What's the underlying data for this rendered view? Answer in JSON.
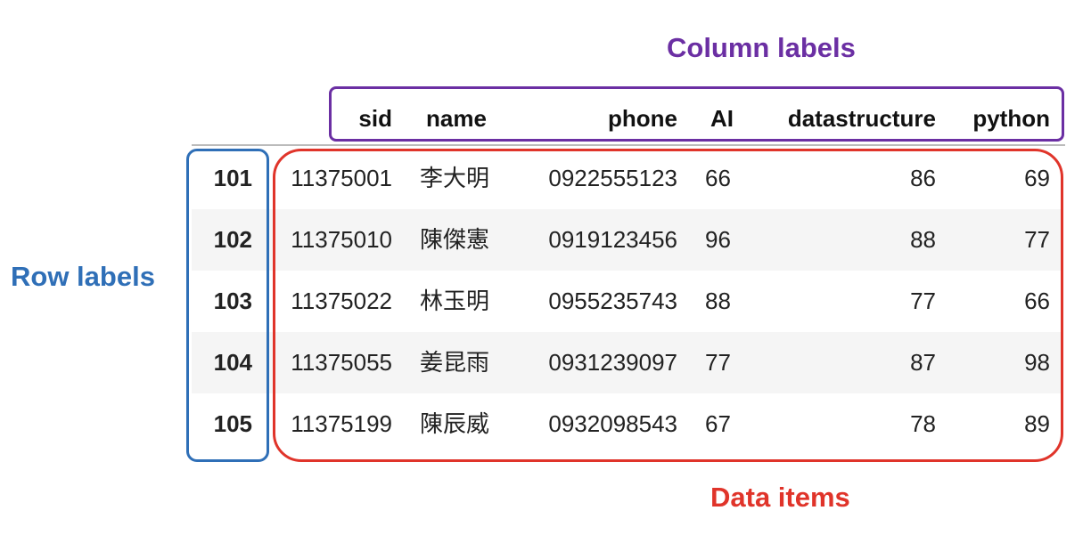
{
  "annotations": {
    "column_labels": {
      "text": "Column labels",
      "color": "#6b2fa3"
    },
    "row_labels": {
      "text": "Row labels",
      "color": "#2f6fb7"
    },
    "data_items": {
      "text": "Data items",
      "color": "#e0342a"
    }
  },
  "table": {
    "columns": [
      "sid",
      "name",
      "phone",
      "AI",
      "datastructure",
      "python"
    ],
    "rows": [
      {
        "index": "101",
        "values": [
          "11375001",
          "李大明",
          "0922555123",
          "66",
          "86",
          "69"
        ]
      },
      {
        "index": "102",
        "values": [
          "11375010",
          "陳傑憲",
          "0919123456",
          "96",
          "88",
          "77"
        ]
      },
      {
        "index": "103",
        "values": [
          "11375022",
          "林玉明",
          "0955235743",
          "88",
          "77",
          "66"
        ]
      },
      {
        "index": "104",
        "values": [
          "11375055",
          "姜昆雨",
          "0931239097",
          "77",
          "87",
          "98"
        ]
      },
      {
        "index": "105",
        "values": [
          "11375199",
          "陳辰威",
          "0932098543",
          "67",
          "78",
          "89"
        ]
      }
    ],
    "stripe_color": "#f5f5f5"
  }
}
